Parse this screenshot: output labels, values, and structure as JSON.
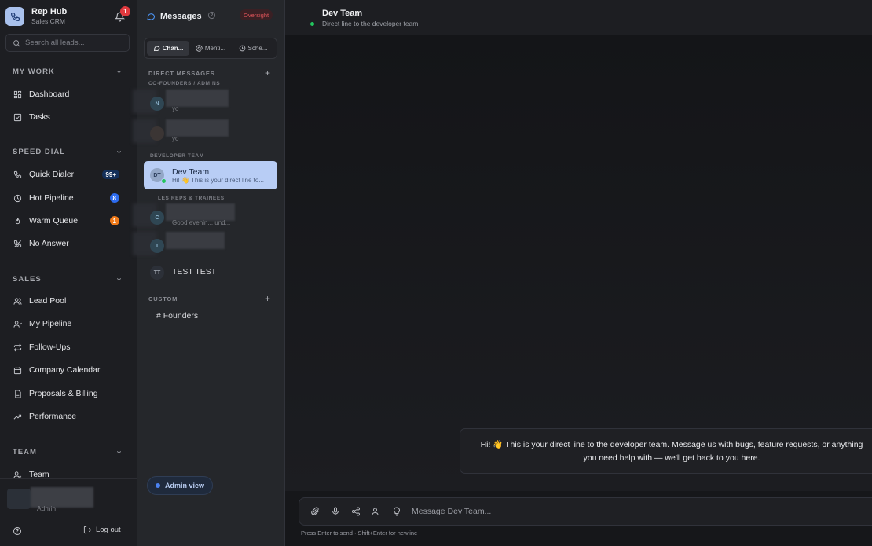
{
  "brand": {
    "name": "Rep Hub",
    "subtitle": "Sales CRM",
    "notif_count": "1"
  },
  "search": {
    "placeholder": "Search all leads..."
  },
  "nav": {
    "my_work": {
      "title": "MY WORK",
      "items": [
        {
          "label": "Dashboard",
          "icon": "grid-icon"
        },
        {
          "label": "Tasks",
          "icon": "checkbox-icon"
        }
      ]
    },
    "speed_dial": {
      "title": "SPEED DIAL",
      "items": [
        {
          "label": "Quick Dialer",
          "icon": "phone-icon",
          "badge": "99+",
          "badge_color": "#14305a"
        },
        {
          "label": "Hot Pipeline",
          "icon": "clock-icon",
          "badge": "8",
          "badge_color": "#2d6cf0"
        },
        {
          "label": "Warm Queue",
          "icon": "flame-icon",
          "badge": "1",
          "badge_color": "#f07a1a"
        },
        {
          "label": "No Answer",
          "icon": "phone-off-icon"
        }
      ]
    },
    "sales": {
      "title": "SALES",
      "items": [
        {
          "label": "Lead Pool",
          "icon": "users-icon"
        },
        {
          "label": "My Pipeline",
          "icon": "user-pipeline-icon"
        },
        {
          "label": "Follow-Ups",
          "icon": "repeat-icon"
        },
        {
          "label": "Company Calendar",
          "icon": "calendar-icon"
        },
        {
          "label": "Proposals & Billing",
          "icon": "document-icon"
        },
        {
          "label": "Performance",
          "icon": "trend-icon"
        }
      ]
    },
    "team": {
      "title": "TEAM",
      "items": [
        {
          "label": "Team",
          "icon": "user-team-icon"
        }
      ]
    }
  },
  "footer": {
    "role": "Admin",
    "logout": "Log out"
  },
  "messages": {
    "title": "Messages",
    "oversight": "Oversight",
    "tabs": [
      {
        "label": "Chan...",
        "icon": "chat-icon"
      },
      {
        "label": "Menti...",
        "icon": "at-icon"
      },
      {
        "label": "Sche...",
        "icon": "clock-icon"
      }
    ],
    "direct_label": "DIRECT MESSAGES",
    "cofounders_label": "CO-FOUNDERS / ADMINS",
    "dev_label": "DEVELOPER TEAM",
    "reps_label": "LES REPS & TRAINEES",
    "custom_label": "CUSTOM",
    "dms": [
      {
        "initial": "N",
        "preview": "yo"
      },
      {
        "initial": "",
        "preview": "yo"
      },
      {
        "initial": "DT",
        "name": "Dev Team",
        "preview": "Hi! 👋 This is your direct line to..."
      },
      {
        "initial": "C",
        "preview": "Good evenin... und..."
      },
      {
        "initial": "T",
        "preview": ""
      },
      {
        "initial": "TT",
        "name": "TEST TEST"
      }
    ],
    "channel": "# Founders",
    "admin_view": "Admin view"
  },
  "conversation": {
    "title": "Dev Team",
    "subtitle": "Direct line to the developer team",
    "welcome_line1": "Hi! 👋 This is your direct line to the developer team. Message us with bugs, feature requests, or anything",
    "welcome_line2": "you need help with — we'll get back to you here.",
    "placeholder": "Message Dev Team...",
    "hint": "Press Enter to send · Shift+Enter for newline"
  },
  "colors": {
    "accent": "#b8cdf5",
    "online": "#22c55e",
    "badge_red": "#e0393e"
  }
}
